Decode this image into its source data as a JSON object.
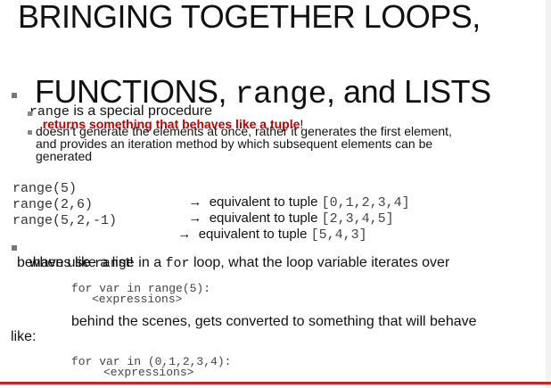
{
  "title": {
    "line1": "BRINGING TOGETHER LOOPS,",
    "line2_pre": "FUNCTIONS, ",
    "line2_code": "range",
    "line2_post": ", and LISTS"
  },
  "bullets": {
    "b1_code": "range",
    "b1_text": " is a special procedure",
    "b1_sub1_red": "returns something that behaves like a tuple",
    "b1_sub1_end": "!",
    "b1_sub2_l1": "doesn’t generate the elements at once, rather it generates the first element,",
    "b1_sub2_l2": "and provides an iteration method by which subsequent elements can be",
    "b1_sub2_l3": "generated"
  },
  "examples": [
    {
      "code": "range(5)",
      "arrow": "→",
      "text": "equivalent to tuple ",
      "tuple": "[0,1,2,3,4]"
    },
    {
      "code": "range(2,6)",
      "arrow": "→",
      "text": "equivalent to tuple ",
      "tuple": "[2,3,4,5]"
    },
    {
      "code": "range(5,2,-1)",
      "arrow": "→",
      "text": "equivalent to tuple ",
      "tuple": "[5,4,3]"
    }
  ],
  "loop_bullet": {
    "t1": "when use ",
    "c1": "range",
    "t2": " in a ",
    "c2": "for",
    "t3": " loop, what the loop variable iterates over",
    "t4": "behaves like a list!"
  },
  "snippets": {
    "code1_l1": "for var in range(5):",
    "code1_l2": "<expressions>",
    "behind_l1": "behind the scenes, gets converted to something that will behave",
    "behind_l2": "like:",
    "code2_l1": "for var in (0,1,2,3,4):",
    "code2_l2": "<expressions>"
  }
}
